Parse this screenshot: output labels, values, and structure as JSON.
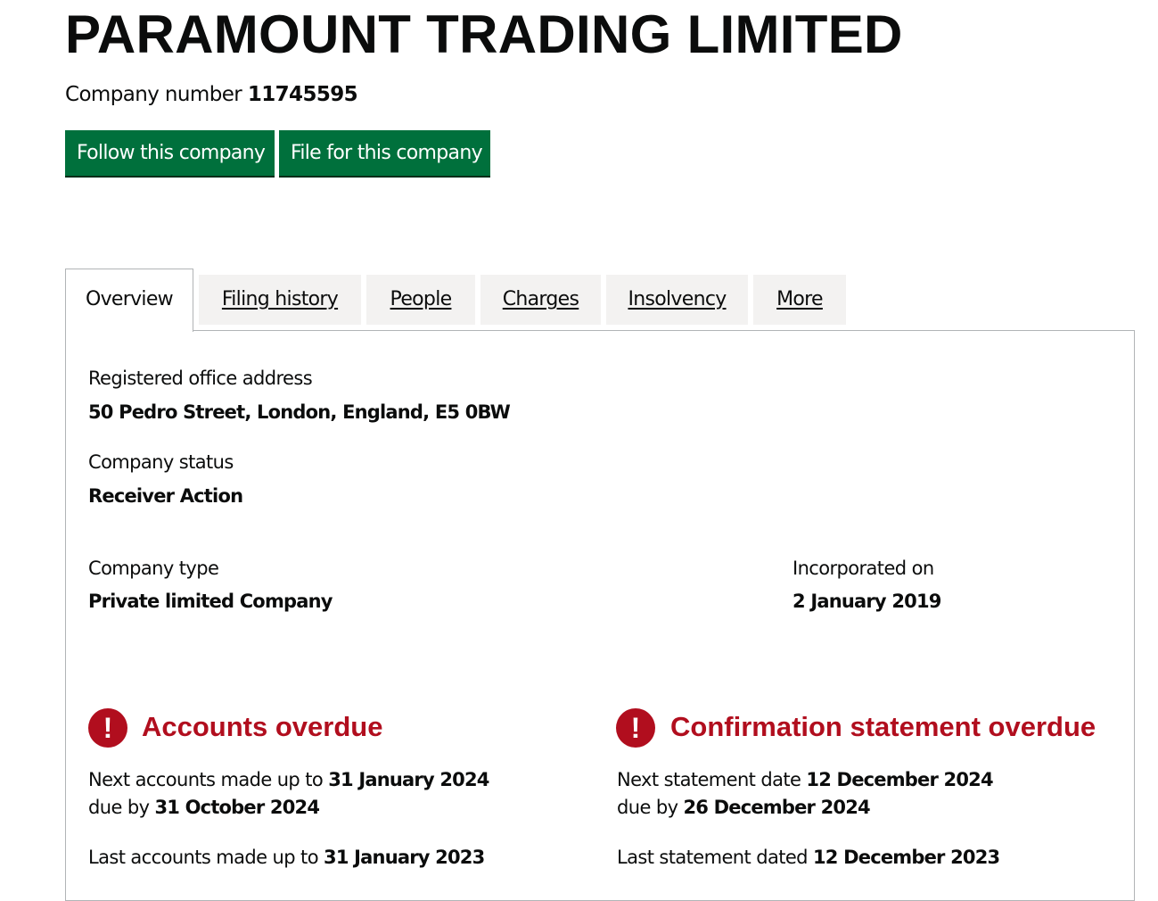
{
  "company": {
    "name": "PARAMOUNT TRADING LIMITED",
    "number_label": "Company number",
    "number": "11745595"
  },
  "actions": {
    "follow_label": "Follow this company",
    "file_label": "File for this company"
  },
  "tabs": [
    {
      "label": "Overview",
      "active": true
    },
    {
      "label": "Filing history",
      "active": false
    },
    {
      "label": "People",
      "active": false
    },
    {
      "label": "Charges",
      "active": false
    },
    {
      "label": "Insolvency",
      "active": false
    },
    {
      "label": "More",
      "active": false
    }
  ],
  "overview": {
    "address_label": "Registered office address",
    "address": "50 Pedro Street, London, England, E5 0BW",
    "status_label": "Company status",
    "status": "Receiver Action",
    "type_label": "Company type",
    "type": "Private limited Company",
    "incorporated_label": "Incorporated on",
    "incorporated": "2 January 2019"
  },
  "accounts": {
    "icon": "!",
    "title": "Accounts overdue",
    "next_prefix": "Next accounts made up to",
    "next_date": "31 January 2024",
    "due_prefix": "due by",
    "due_date": "31 October 2024",
    "last_prefix": "Last accounts made up to",
    "last_date": "31 January 2023"
  },
  "confirmation": {
    "icon": "!",
    "title": "Confirmation statement overdue",
    "next_prefix": "Next statement date",
    "next_date": "12 December 2024",
    "due_prefix": "due by",
    "due_date": "26 December 2024",
    "last_prefix": "Last statement dated",
    "last_date": "12 December 2023"
  },
  "colors": {
    "button_green": "#00703c",
    "warning_red": "#b10e1e",
    "tab_grey": "#f3f2f1",
    "border_grey": "#b1b4b6"
  }
}
